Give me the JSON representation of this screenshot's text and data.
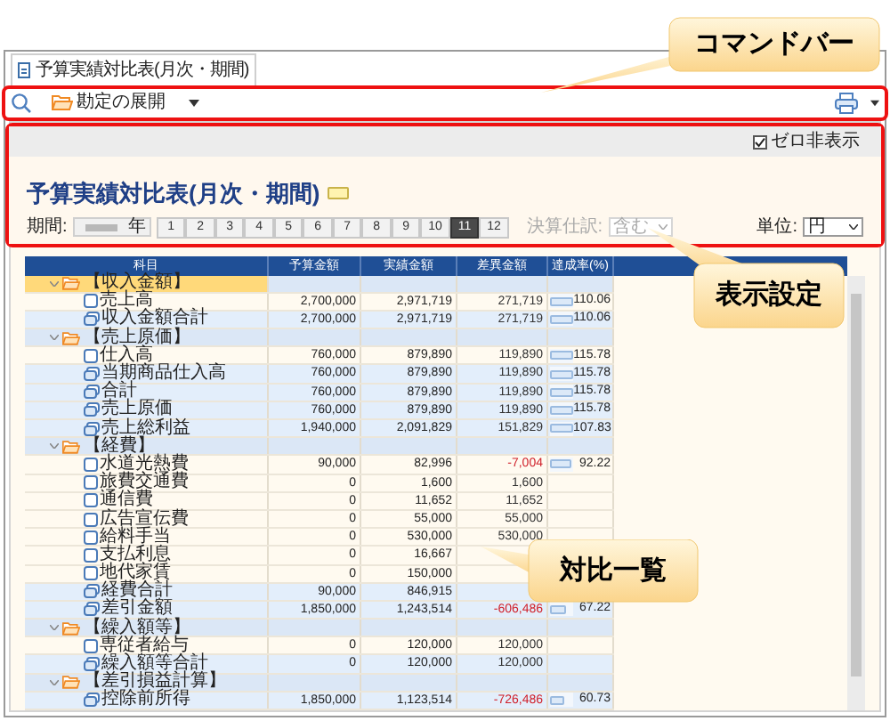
{
  "tab": {
    "label": "予算実績対比表(月次・期間)"
  },
  "command_bar": {
    "expand_label": "勘定の展開"
  },
  "settings": {
    "zero_hide": {
      "label": "ゼロ非表示",
      "checked": true
    },
    "title": "予算実績対比表(月次・期間)",
    "period_label": "期間:",
    "year_suffix": "年",
    "months": [
      {
        "label": "1",
        "selected": false
      },
      {
        "label": "2",
        "selected": false
      },
      {
        "label": "3",
        "selected": false
      },
      {
        "label": "4",
        "selected": false
      },
      {
        "label": "5",
        "selected": false
      },
      {
        "label": "6",
        "selected": false
      },
      {
        "label": "7",
        "selected": false
      },
      {
        "label": "8",
        "selected": false
      },
      {
        "label": "9",
        "selected": false
      },
      {
        "label": "10",
        "selected": false
      },
      {
        "label": "11",
        "selected": true
      },
      {
        "label": "12",
        "selected": false
      }
    ],
    "closing_label": "決算仕訳:",
    "closing_value": "含む",
    "unit_label": "単位:",
    "unit_value": "円"
  },
  "table": {
    "columns": [
      "科目",
      "予算金額",
      "実績金額",
      "差異金額",
      "達成率(%)"
    ],
    "groups": [
      {
        "name": "【収入金額】",
        "selected": true,
        "children": [
          {
            "kind": "item",
            "name": "売上高",
            "budget": "2,700,000",
            "actual": "2,971,719",
            "diff": "271,719",
            "diff_negative": false,
            "rate": "110.06",
            "level": 1
          },
          {
            "kind": "total",
            "name": "収入金額合計",
            "budget": "2,700,000",
            "actual": "2,971,719",
            "diff": "271,719",
            "diff_negative": false,
            "rate": "110.06",
            "level": 1
          }
        ]
      },
      {
        "name": "【売上原価】",
        "selected": false,
        "children": [
          {
            "kind": "item",
            "name": "仕入高",
            "budget": "760,000",
            "actual": "879,890",
            "diff": "119,890",
            "diff_negative": false,
            "rate": "115.78",
            "level": 1
          },
          {
            "kind": "total",
            "name": "当期商品仕入高",
            "budget": "760,000",
            "actual": "879,890",
            "diff": "119,890",
            "diff_negative": false,
            "rate": "115.78",
            "level": 1
          },
          {
            "kind": "total",
            "name": "合計",
            "budget": "760,000",
            "actual": "879,890",
            "diff": "119,890",
            "diff_negative": false,
            "rate": "115.78",
            "level": 1
          },
          {
            "kind": "total",
            "name": "売上原価",
            "budget": "760,000",
            "actual": "879,890",
            "diff": "119,890",
            "diff_negative": false,
            "rate": "115.78",
            "level": 1
          },
          {
            "kind": "total",
            "name": "売上総利益",
            "budget": "1,940,000",
            "actual": "2,091,829",
            "diff": "151,829",
            "diff_negative": false,
            "rate": "107.83",
            "level": 1
          }
        ]
      },
      {
        "name": "【経費】",
        "selected": false,
        "children": [
          {
            "kind": "item",
            "name": "水道光熱費",
            "budget": "90,000",
            "actual": "82,996",
            "diff": "-7,004",
            "diff_negative": true,
            "rate": "92.22",
            "level": 0.92
          },
          {
            "kind": "item",
            "name": "旅費交通費",
            "budget": "0",
            "actual": "1,600",
            "diff": "1,600",
            "diff_negative": false
          },
          {
            "kind": "item",
            "name": "通信費",
            "budget": "0",
            "actual": "11,652",
            "diff": "11,652",
            "diff_negative": false
          },
          {
            "kind": "item",
            "name": "広告宣伝費",
            "budget": "0",
            "actual": "55,000",
            "diff": "55,000",
            "diff_negative": false
          },
          {
            "kind": "item",
            "name": "給料手当",
            "budget": "0",
            "actual": "530,000",
            "diff": "530,000",
            "diff_negative": false
          },
          {
            "kind": "item",
            "name": "支払利息",
            "budget": "0",
            "actual": "16,667"
          },
          {
            "kind": "item",
            "name": "地代家賃",
            "budget": "0",
            "actual": "150,000"
          },
          {
            "kind": "total",
            "name": "経費合計",
            "budget": "90,000",
            "actual": "846,915"
          },
          {
            "kind": "total",
            "name": "差引金額",
            "budget": "1,850,000",
            "actual": "1,243,514",
            "diff": "-606,486",
            "diff_negative": true,
            "rate": "67.22",
            "level": 0.67
          }
        ]
      },
      {
        "name": "【繰入額等】",
        "selected": false,
        "children": [
          {
            "kind": "item",
            "name": "専従者給与",
            "budget": "0",
            "actual": "120,000",
            "diff": "120,000",
            "diff_negative": false
          },
          {
            "kind": "total",
            "name": "繰入額等合計",
            "budget": "0",
            "actual": "120,000",
            "diff": "120,000",
            "diff_negative": false
          }
        ]
      },
      {
        "name": "【差引損益計算】",
        "selected": false,
        "children": [
          {
            "kind": "total",
            "name": "控除前所得",
            "budget": "1,850,000",
            "actual": "1,123,514",
            "diff": "-726,486",
            "diff_negative": true,
            "rate": "60.73",
            "level": 0.61
          }
        ]
      }
    ]
  },
  "callouts": [
    {
      "label": "コマンドバー"
    },
    {
      "label": "表示設定"
    },
    {
      "label": "対比一覧"
    }
  ]
}
